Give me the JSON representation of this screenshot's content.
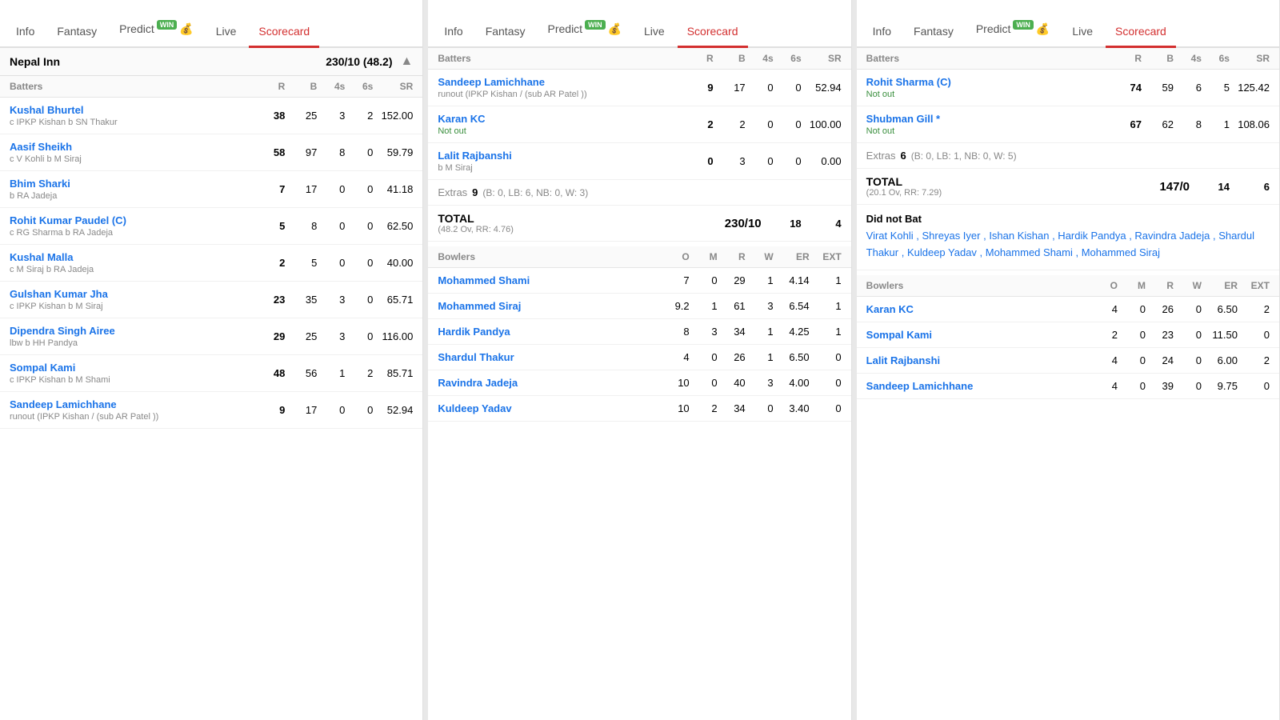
{
  "panels": [
    {
      "id": "panel-nepal",
      "tabs": [
        {
          "label": "Info",
          "active": false
        },
        {
          "label": "Fantasy",
          "active": false
        },
        {
          "label": "Predict",
          "active": false,
          "win": true
        },
        {
          "label": "Live",
          "active": false
        },
        {
          "label": "Scorecard",
          "active": true
        }
      ],
      "team": {
        "name": "Nepal Inn",
        "score": "230/10",
        "overs": "48.2",
        "collapsed": false
      },
      "batters_header": {
        "cols": [
          "Batters",
          "R",
          "B",
          "4s",
          "6s",
          "SR"
        ]
      },
      "batters": [
        {
          "name": "Kushal Bhurtel",
          "dismiss": "c IPKP Kishan b SN Thakur",
          "r": 38,
          "b": 25,
          "fours": 3,
          "sixes": 2,
          "sr": "152.00"
        },
        {
          "name": "Aasif Sheikh",
          "dismiss": "c V Kohli b M Siraj",
          "r": 58,
          "b": 97,
          "fours": 8,
          "sixes": 0,
          "sr": "59.79"
        },
        {
          "name": "Bhim Sharki",
          "dismiss": "b RA Jadeja",
          "r": 7,
          "b": 17,
          "fours": 0,
          "sixes": 0,
          "sr": "41.18"
        },
        {
          "name": "Rohit Kumar Paudel (C)",
          "dismiss": "c RG Sharma b RA Jadeja",
          "r": 5,
          "b": 8,
          "fours": 0,
          "sixes": 0,
          "sr": "62.50"
        },
        {
          "name": "Kushal Malla",
          "dismiss": "c M Siraj b RA Jadeja",
          "r": 2,
          "b": 5,
          "fours": 0,
          "sixes": 0,
          "sr": "40.00"
        },
        {
          "name": "Gulshan Kumar Jha",
          "dismiss": "c IPKP Kishan b M Siraj",
          "r": 23,
          "b": 35,
          "fours": 3,
          "sixes": 0,
          "sr": "65.71"
        },
        {
          "name": "Dipendra Singh Airee",
          "dismiss": "lbw b HH Pandya",
          "r": 29,
          "b": 25,
          "fours": 3,
          "sixes": 0,
          "sr": "116.00"
        },
        {
          "name": "Sompal Kami",
          "dismiss": "c IPKP Kishan b M Shami",
          "r": 48,
          "b": 56,
          "fours": 1,
          "sixes": 2,
          "sr": "85.71"
        },
        {
          "name": "Sandeep Lamichhane",
          "dismiss": "runout (IPKP Kishan / (sub AR Patel ))",
          "r": 9,
          "b": 17,
          "fours": 0,
          "sixes": 0,
          "sr": "52.94"
        }
      ],
      "extras": {
        "val": 9,
        "detail": "(B: 0, LB: 6, NB: 0, W: 3)"
      },
      "total": {
        "score": "230/10",
        "overs": "48.2 Ov, RR: 4.76",
        "fours": 18,
        "sixes": 4
      }
    },
    {
      "id": "panel-nepal2",
      "tabs": [
        {
          "label": "Info",
          "active": false
        },
        {
          "label": "Fantasy",
          "active": false
        },
        {
          "label": "Predict",
          "active": false,
          "win": true
        },
        {
          "label": "Live",
          "active": false
        },
        {
          "label": "Scorecard",
          "active": true
        }
      ],
      "show_batters_section": true,
      "batters": [
        {
          "name": "Sandeep Lamichhane",
          "dismiss": "runout (IPKP Kishan / (sub AR Patel ))",
          "r": 9,
          "b": 17,
          "fours": 0,
          "sixes": 0,
          "sr": "52.94"
        },
        {
          "name": "Karan KC",
          "dismiss": "Not out",
          "notout": true,
          "r": 2,
          "b": 2,
          "fours": 0,
          "sixes": 0,
          "sr": "100.00"
        },
        {
          "name": "Lalit Rajbanshi",
          "dismiss": "b M Siraj",
          "r": 0,
          "b": 3,
          "fours": 0,
          "sixes": 0,
          "sr": "0.00"
        }
      ],
      "extras": {
        "val": 9,
        "detail": "(B: 0, LB: 6, NB: 0, W: 3)"
      },
      "total": {
        "score": "230/10",
        "overs": "48.2 Ov, RR: 4.76",
        "fours": 18,
        "sixes": 4
      },
      "bowlers_header": {
        "cols": [
          "Bowlers",
          "O",
          "M",
          "R",
          "W",
          "ER",
          "EXT"
        ]
      },
      "bowlers": [
        {
          "name": "Mohammed Shami",
          "o": "7",
          "m": 0,
          "r": 29,
          "w": 1,
          "er": "4.14",
          "ext": 1
        },
        {
          "name": "Mohammed Siraj",
          "o": "9.2",
          "m": 1,
          "r": 61,
          "w": 3,
          "er": "6.54",
          "ext": 1
        },
        {
          "name": "Hardik Pandya",
          "o": "8",
          "m": 3,
          "r": 34,
          "w": 1,
          "er": "4.25",
          "ext": 1
        },
        {
          "name": "Shardul Thakur",
          "o": "4",
          "m": 0,
          "r": 26,
          "w": 1,
          "er": "6.50",
          "ext": 0
        },
        {
          "name": "Ravindra Jadeja",
          "o": "10",
          "m": 0,
          "r": 40,
          "w": 3,
          "er": "4.00",
          "ext": 0
        },
        {
          "name": "Kuldeep Yadav",
          "o": "10",
          "m": 2,
          "r": 34,
          "w": 0,
          "er": "3.40",
          "ext": 0
        }
      ]
    },
    {
      "id": "panel-india",
      "tabs": [
        {
          "label": "Info",
          "active": false
        },
        {
          "label": "Fantasy",
          "active": false
        },
        {
          "label": "Predict",
          "active": false,
          "win": true
        },
        {
          "label": "Live",
          "active": false
        },
        {
          "label": "Scorecard",
          "active": true
        }
      ],
      "batters_header": {
        "cols": [
          "Batters",
          "R",
          "B",
          "4s",
          "6s",
          "SR"
        ]
      },
      "batters": [
        {
          "name": "Rohit Sharma (C)",
          "dismiss": "Not out",
          "notout": true,
          "r": 74,
          "b": 59,
          "fours": 6,
          "sixes": 5,
          "sr": "125.42"
        },
        {
          "name": "Shubman Gill *",
          "dismiss": "Not out",
          "notout": true,
          "r": 67,
          "b": 62,
          "fours": 8,
          "sixes": 1,
          "sr": "108.06"
        }
      ],
      "extras": {
        "val": 6,
        "detail": "(B: 0, LB: 1, NB: 0, W: 5)"
      },
      "total": {
        "score": "147/0",
        "overs": "20.1 Ov, RR: 7.29",
        "fours": 14,
        "sixes": 6
      },
      "dnb": {
        "label": "Did not Bat",
        "players": "Virat Kohli , Shreyas Iyer , Ishan Kishan , Hardik Pandya , Ravindra Jadeja , Shardul Thakur , Kuldeep Yadav , Mohammed Shami , Mohammed Siraj"
      },
      "bowlers_header": {
        "cols": [
          "Bowlers",
          "O",
          "M",
          "R",
          "W",
          "ER",
          "EXT"
        ]
      },
      "bowlers": [
        {
          "name": "Karan KC",
          "o": "4",
          "m": 0,
          "r": 26,
          "w": 0,
          "er": "6.50",
          "ext": 2
        },
        {
          "name": "Sompal Kami",
          "o": "2",
          "m": 0,
          "r": 23,
          "w": 0,
          "er": "11.50",
          "ext": 0
        },
        {
          "name": "Lalit Rajbanshi",
          "o": "4",
          "m": 0,
          "r": 24,
          "w": 0,
          "er": "6.00",
          "ext": 2
        },
        {
          "name": "Sandeep Lamichhane",
          "o": "4",
          "m": 0,
          "r": 39,
          "w": 0,
          "er": "9.75",
          "ext": 0
        }
      ]
    }
  ],
  "labels": {
    "info": "Info",
    "fantasy": "Fantasy",
    "predict": "Predict",
    "live": "Live",
    "scorecard": "Scorecard",
    "batters": "Batters",
    "bowlers": "Bowlers",
    "r": "R",
    "b": "B",
    "fours": "4s",
    "sixes": "6s",
    "sr": "SR",
    "o": "O",
    "m": "M",
    "w": "W",
    "er": "ER",
    "ext": "EXT",
    "extras": "Extras",
    "total": "TOTAL",
    "did_not_bat": "Did not Bat",
    "not_out": "Not out",
    "win": "WIN"
  }
}
